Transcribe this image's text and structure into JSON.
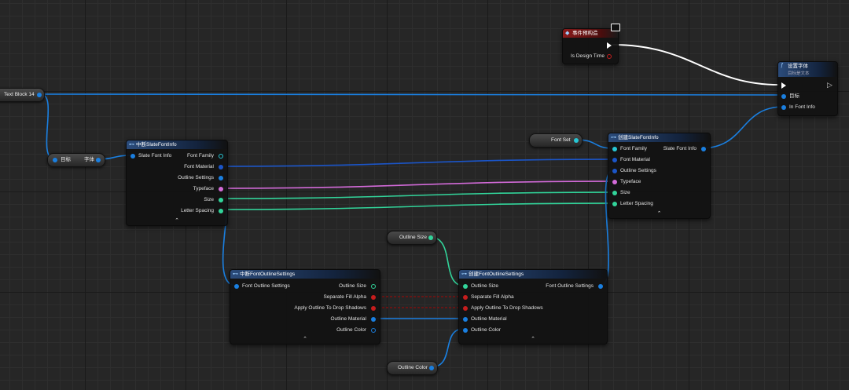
{
  "colors": {
    "struct_pin": "#1a7fe0",
    "object_pin": "#1b55c8",
    "exec_wire": "#ffffff",
    "bool_pin": "#c61d1d",
    "float_pin": "#32d49a",
    "name_pin": "#d26ad8",
    "event_header": "#8a1b1b",
    "function_header": "#2b4b7a"
  },
  "event_node": {
    "title": "事件预构造",
    "icon": "event-diamond-icon",
    "pin_design_time": "Is Design Time"
  },
  "set_font_node": {
    "title": "设置字体",
    "subtitle": "目标是文本",
    "icon": "function-icon",
    "pin_target": "目标",
    "pin_in_font_info": "In Font Info"
  },
  "text_block_pill": {
    "label": "Text Block 14"
  },
  "get_font_pill": {
    "label_target": "目标",
    "label_font": "字体"
  },
  "break_slate_node": {
    "title": "中断SlateFontInfo",
    "icon": "struct-icon",
    "pin_in": "Slate Font Info",
    "outputs": [
      "Font Family",
      "Font Material",
      "Outline Settings",
      "Typeface",
      "Size",
      "Letter Spacing"
    ]
  },
  "font_set_pill": {
    "label": "Font Set"
  },
  "make_slate_node": {
    "title": "创建SlateFontInfo",
    "icon": "struct-icon",
    "output": "Slate Font Info",
    "inputs": [
      "Font Family",
      "Font Material",
      "Outline Settings",
      "Typeface",
      "Size",
      "Letter Spacing"
    ]
  },
  "outline_size_pill": {
    "label": "Outline Size"
  },
  "break_outline_node": {
    "title": "中断FontOutlineSettings",
    "icon": "struct-icon",
    "pin_in": "Font Outline Settings",
    "outputs": [
      "Outline Size",
      "Separate Fill Alpha",
      "Apply Outline To Drop Shadows",
      "Outline Material",
      "Outline Color"
    ]
  },
  "make_outline_node": {
    "title": "创建FontOutlineSettings",
    "icon": "struct-icon",
    "output": "Font Outline Settings",
    "inputs": [
      "Outline Size",
      "Separate Fill Alpha",
      "Apply Outline To Drop Shadows",
      "Outline Material",
      "Outline Color"
    ]
  },
  "outline_color_pill": {
    "label": "Outline Color"
  }
}
